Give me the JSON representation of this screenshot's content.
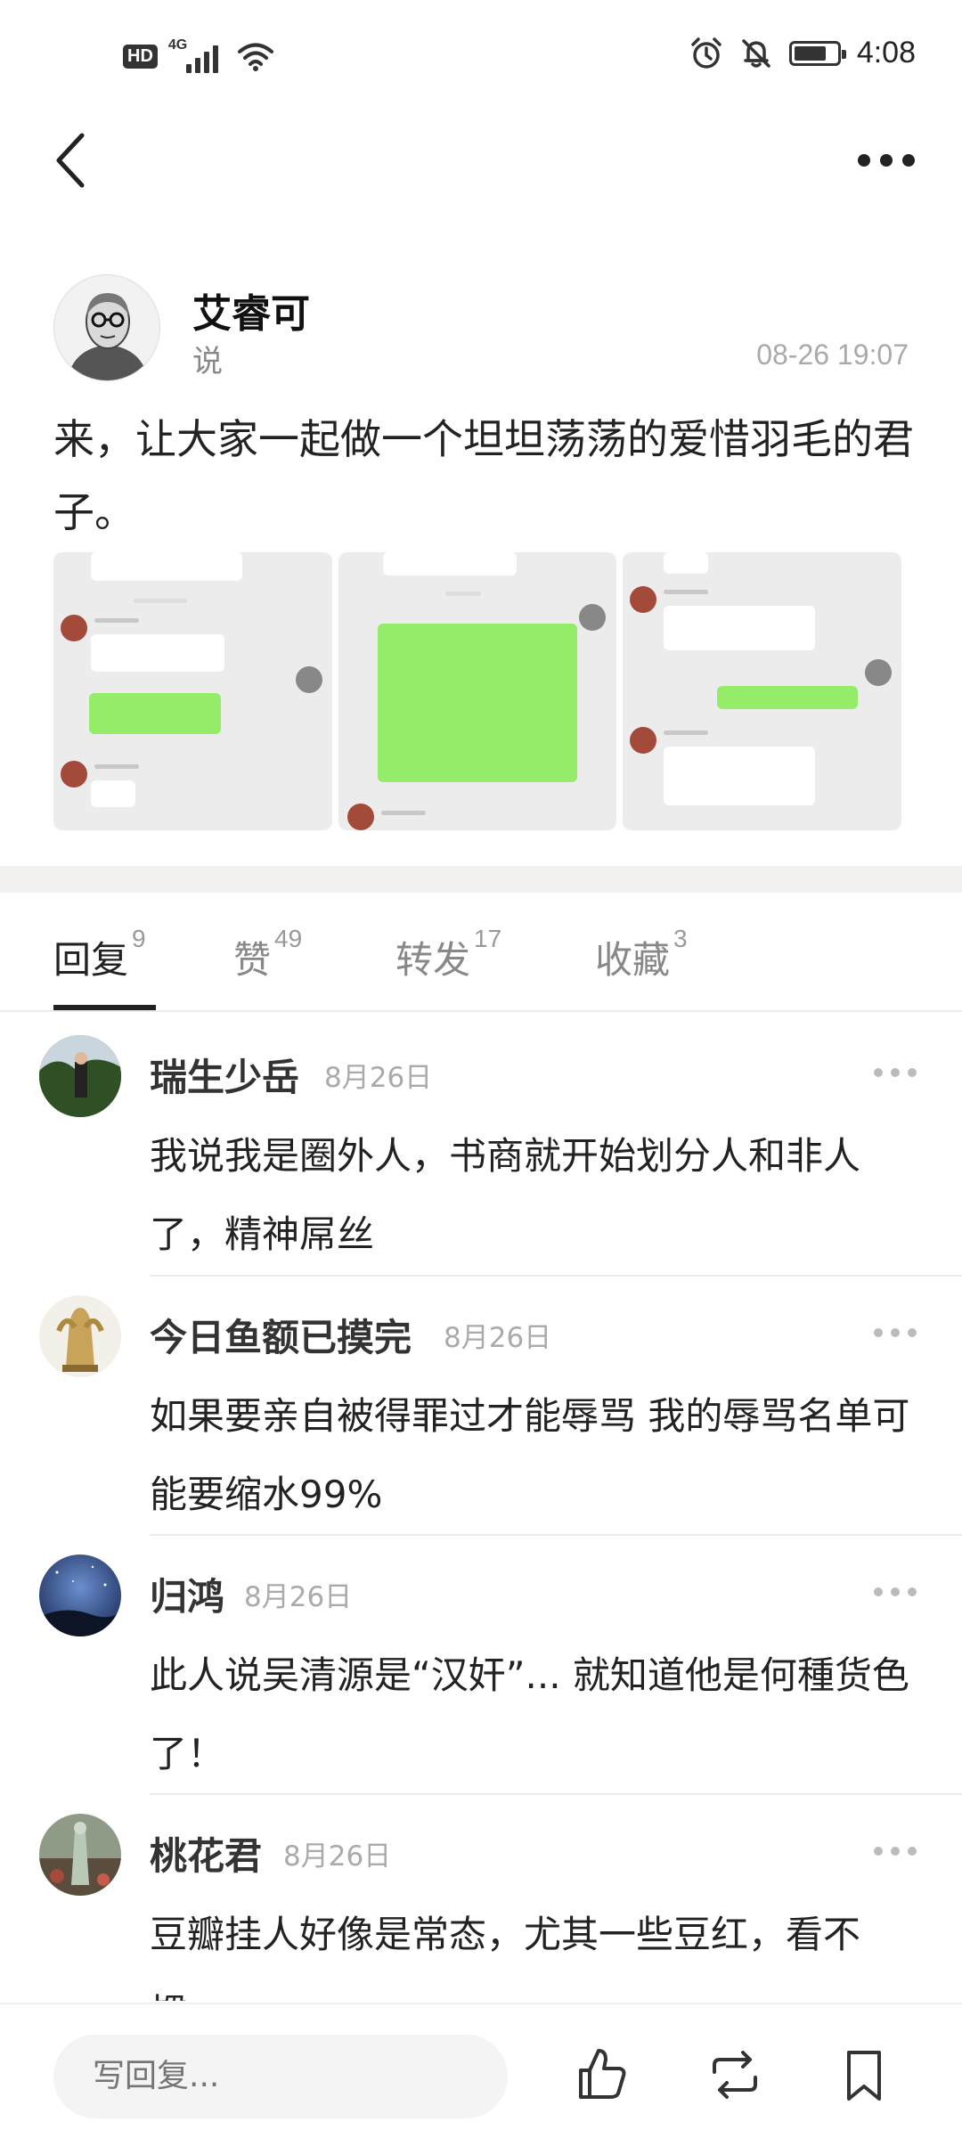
{
  "status_bar": {
    "hd": "HD",
    "network": "4G",
    "time": "4:08",
    "battery_level": 0.75
  },
  "post": {
    "author": "艾睿可",
    "verb": "说",
    "time": "08-26 19:07",
    "text": "来，让大家一起做一个坦坦荡荡的爱惜羽毛的君子。"
  },
  "tabs": [
    {
      "label": "回复",
      "count": "9"
    },
    {
      "label": "赞",
      "count": "49"
    },
    {
      "label": "转发",
      "count": "17"
    },
    {
      "label": "收藏",
      "count": "3"
    }
  ],
  "comments": [
    {
      "name": "瑞生少岳",
      "date": "8月26日",
      "text": "我说我是圈外人，书商就开始划分人和非人了，精神屌丝"
    },
    {
      "name": "今日鱼额已摸完",
      "date": "8月26日",
      "text": "如果要亲自被得罪过才能辱骂  我的辱骂名单可能要缩水99%"
    },
    {
      "name": "归鸿",
      "date": "8月26日",
      "text": "此人说吴清源是“汉奸”... 就知道他是何種货色了！"
    },
    {
      "name": "桃花君",
      "date": "8月26日",
      "text": "豆瓣挂人好像是常态，尤其一些豆红，看不惯。"
    }
  ],
  "reply_box": {
    "placeholder": "写回复..."
  },
  "icons": {
    "back": "chevron-left-icon",
    "more": "more-dots-icon",
    "like": "thumbs-up-icon",
    "repost": "repost-icon",
    "bookmark": "bookmark-icon"
  }
}
